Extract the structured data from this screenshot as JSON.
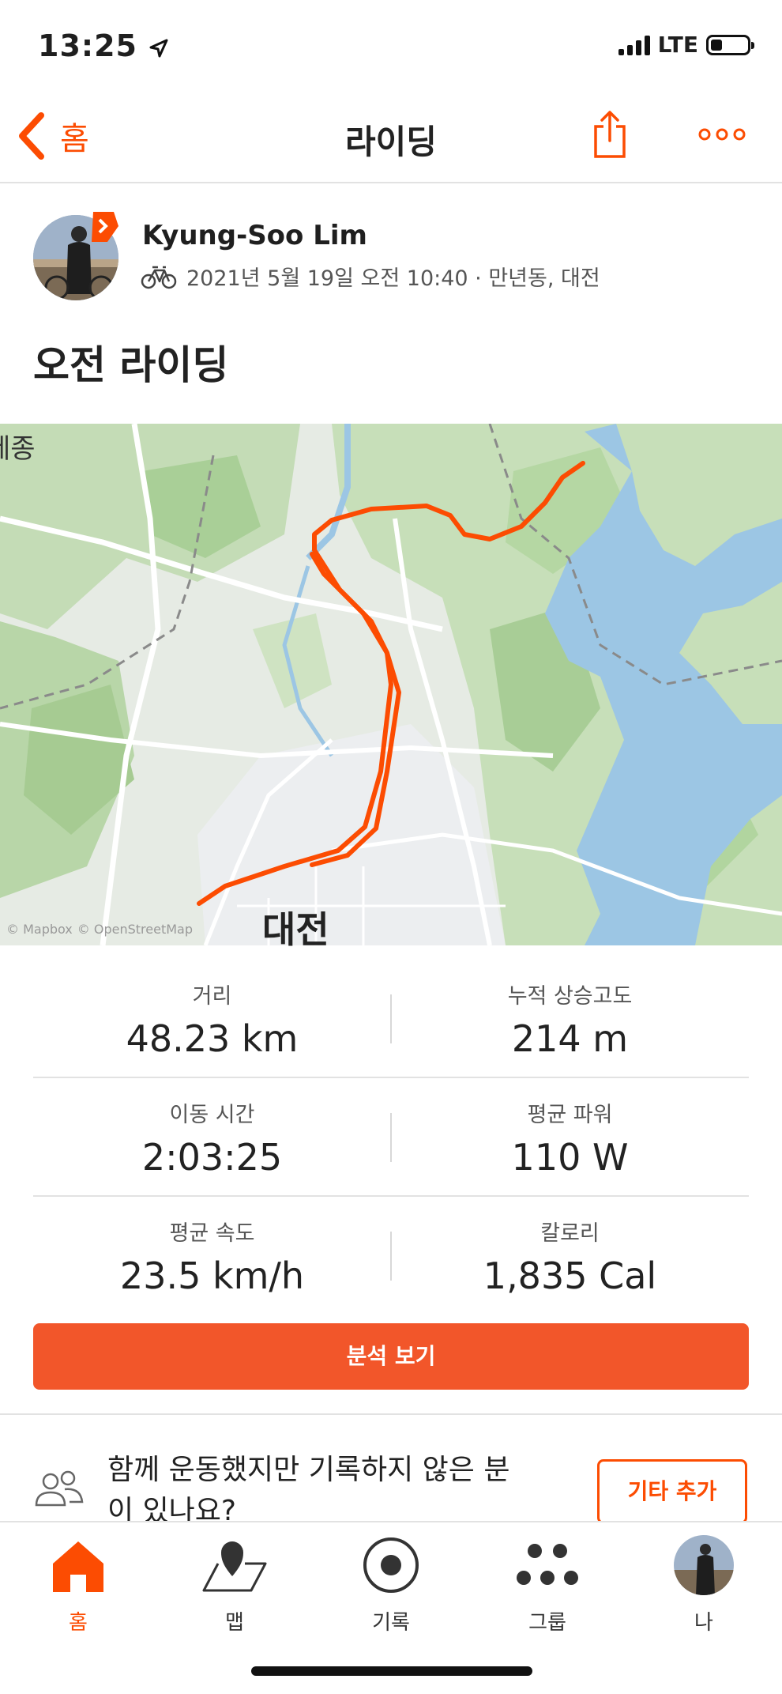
{
  "status_bar": {
    "time": "13:25",
    "network": "LTE"
  },
  "nav": {
    "back_label": "홈",
    "title": "라이딩"
  },
  "activity": {
    "athlete_name": "Kyung-Soo Lim",
    "meta": "2021년 5월 19일 오전 10:40 · 만년동, 대전",
    "title": "오전 라이딩"
  },
  "map": {
    "label_city": "대전",
    "label_sejong": "세종",
    "attribution_1": "© Mapbox",
    "attribution_2": "© OpenStreetMap",
    "route_color": "#fc4c02"
  },
  "stats": [
    {
      "label": "거리",
      "value": "48.23 km"
    },
    {
      "label": "누적 상승고도",
      "value": "214 m"
    },
    {
      "label": "이동 시간",
      "value": "2:03:25"
    },
    {
      "label": "평균 파워",
      "value": "110 W"
    },
    {
      "label": "평균 속도",
      "value": "23.5 km/h"
    },
    {
      "label": "칼로리",
      "value": "1,835 Cal"
    }
  ],
  "analyze_button": "분석 보기",
  "group_prompt": {
    "text": "함께 운동했지만 기록하지 않은 분이 있나요?",
    "button": "기타 추가"
  },
  "tabs": [
    {
      "label": "홈",
      "icon": "home-icon",
      "active": true
    },
    {
      "label": "맵",
      "icon": "map-icon",
      "active": false
    },
    {
      "label": "기록",
      "icon": "record-icon",
      "active": false
    },
    {
      "label": "그룹",
      "icon": "groups-icon",
      "active": false
    },
    {
      "label": "나",
      "icon": "profile-avatar",
      "active": false
    }
  ],
  "colors": {
    "accent": "#fc4c02",
    "button": "#f2562a"
  }
}
